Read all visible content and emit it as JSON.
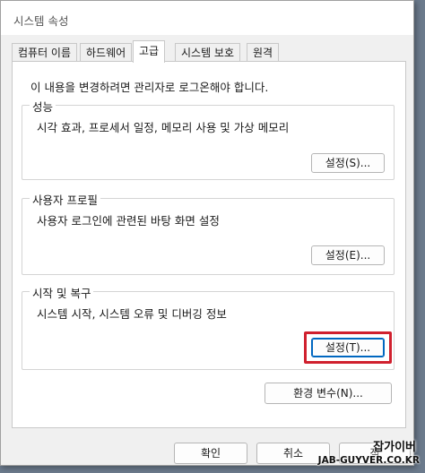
{
  "window": {
    "title": "시스템 속성"
  },
  "tabs": [
    {
      "label": "컴퓨터 이름"
    },
    {
      "label": "하드웨어"
    },
    {
      "label": "고급"
    },
    {
      "label": "시스템 보호"
    },
    {
      "label": "원격"
    }
  ],
  "active_tab": "고급",
  "notice": "이 내용을 변경하려면 관리자로 로그온해야 합니다.",
  "groups": {
    "performance": {
      "title": "성능",
      "desc": "시각 효과, 프로세서 일정, 메모리 사용 및 가상 메모리",
      "button": "설정(S)..."
    },
    "profiles": {
      "title": "사용자 프로필",
      "desc": "사용자 로그인에 관련된 바탕 화면 설정",
      "button": "설정(E)..."
    },
    "startup": {
      "title": "시작 및 복구",
      "desc": "시스템 시작, 시스템 오류 및 디버깅 정보",
      "button": "설정(T)..."
    }
  },
  "env_button": "환경 변수(N)...",
  "dialog_buttons": {
    "ok": "확인",
    "cancel": "취소",
    "apply": "적"
  },
  "watermark": {
    "name": "잡가이버",
    "url": "JAB-GUYVER.CO.KR"
  },
  "colors": {
    "highlight": "#d0202e",
    "focus": "#0067c0"
  }
}
